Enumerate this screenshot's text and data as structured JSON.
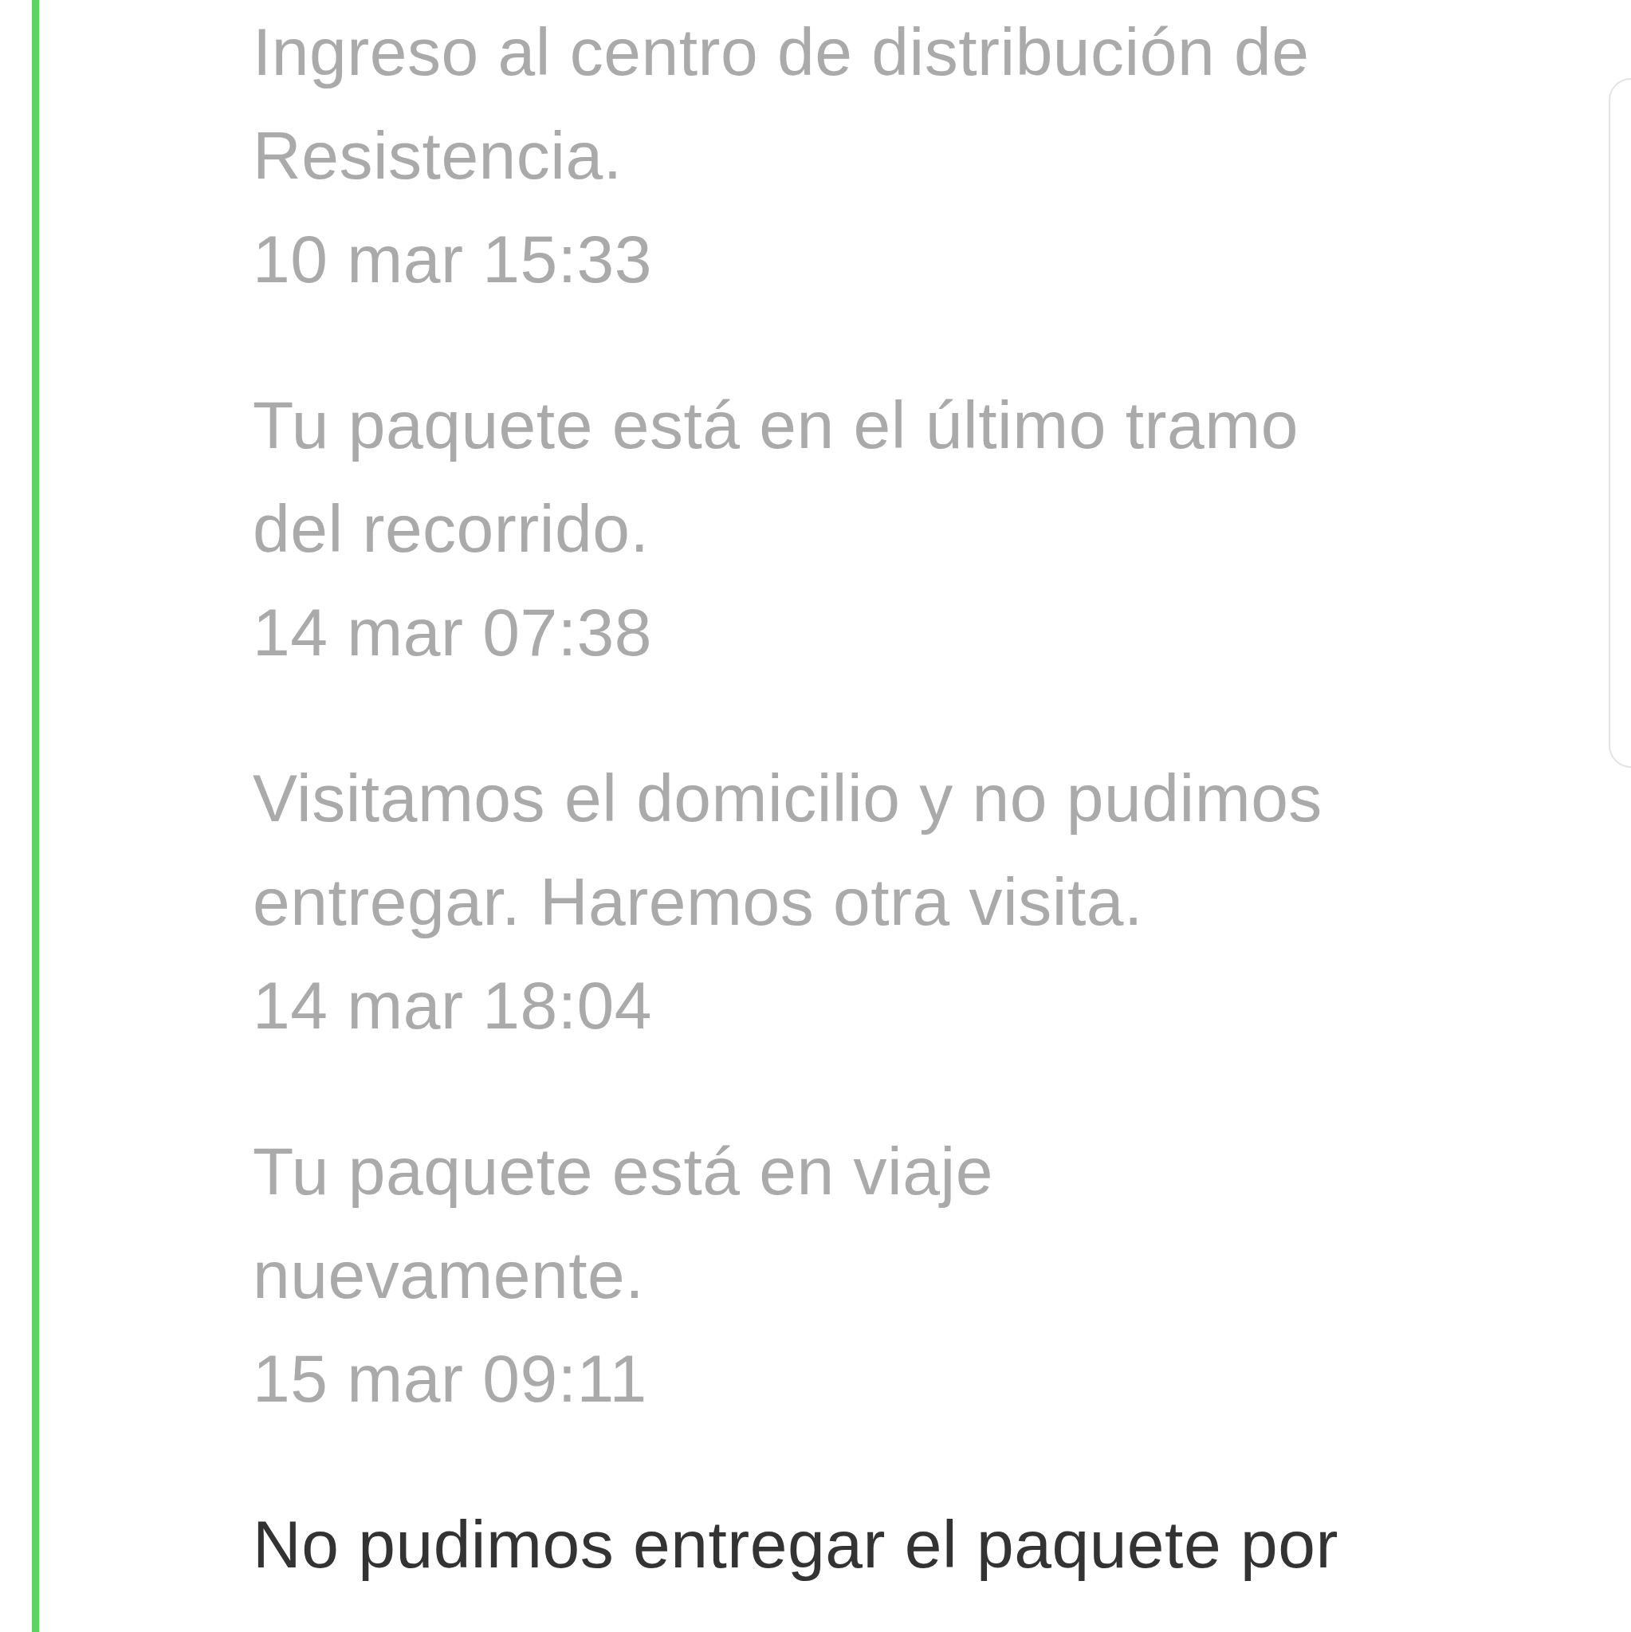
{
  "events": [
    {
      "description": "Ingreso al centro de distribución de Resistencia.",
      "time": "10 mar 15:33",
      "current": false
    },
    {
      "description": "Tu paquete está en el último tramo del recorrido.",
      "time": "14 mar 07:38",
      "current": false
    },
    {
      "description": "Visitamos el domicilio y no pudimos entregar. Haremos otra visita.",
      "time": "14 mar 18:04",
      "current": false
    },
    {
      "description": "Tu paquete está en viaje nuevamente.",
      "time": "15 mar 09:11",
      "current": false
    },
    {
      "description": "No pudimos entregar el paquete por",
      "current": true
    }
  ]
}
